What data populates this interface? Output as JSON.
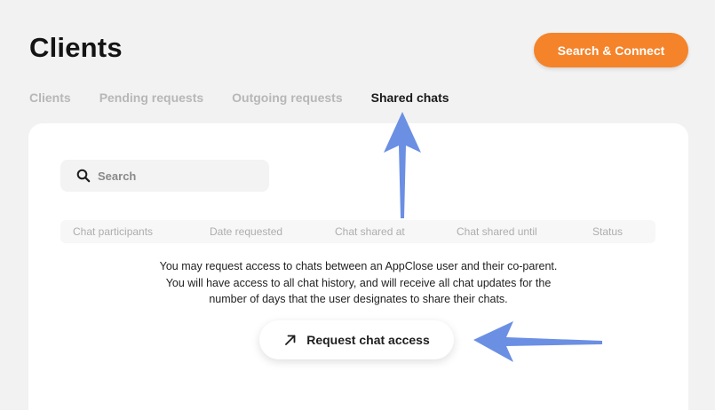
{
  "header": {
    "title": "Clients",
    "primary_button": "Search & Connect"
  },
  "tabs": [
    {
      "label": "Clients",
      "active": false
    },
    {
      "label": "Pending requests",
      "active": false
    },
    {
      "label": "Outgoing requests",
      "active": false
    },
    {
      "label": "Shared chats",
      "active": true
    }
  ],
  "search": {
    "placeholder": "Search",
    "value": "",
    "icon": "search-icon"
  },
  "table": {
    "columns": [
      "Chat participants",
      "Date requested",
      "Chat shared at",
      "Chat shared until",
      "Status"
    ]
  },
  "empty_state": {
    "lines": [
      "You may request access to chats between an AppClose user and their co-parent.",
      "You will have access to all chat history, and will receive all chat updates for the",
      "number of days that the user designates to share their chats."
    ],
    "button_label": "Request chat access",
    "button_icon": "arrow-up-right-icon"
  },
  "colors": {
    "accent": "#f5832a",
    "annotation_arrow": "#6b8fe3",
    "background": "#f2f2f2",
    "card": "#ffffff"
  }
}
